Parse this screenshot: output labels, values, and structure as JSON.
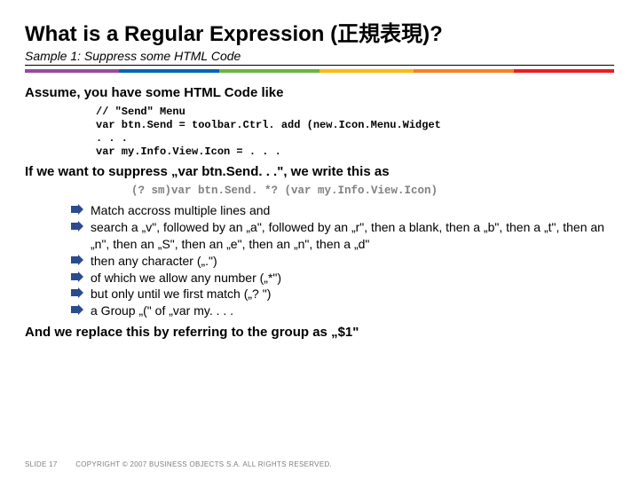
{
  "title": "What is a Regular Expression (正規表現)?",
  "subtitle": "Sample 1: Suppress some HTML Code",
  "h_assume": "Assume, you have some HTML Code like",
  "code1": "// \"Send\" Menu\nvar btn.Send = toolbar.Ctrl. add (new.Icon.Menu.Widget\n. . .\nvar my.Info.View.Icon = . . .",
  "h_want": "If we want to suppress „var btn.Send. . .\", we write this as",
  "regex": "(? sm)var btn.Send. *? (var my.Info.View.Icon)",
  "bullets": {
    "b1": "Match accross multiple lines and",
    "b2": "search a „v\", followed by an „a\", followed by an „r\", then a blank, then a „b\", then a „t\", then an „n\", then an „S\", then an „e\", then an „n\", then a „d\"",
    "b3": "then any character („.\")",
    "b4": "of which we allow any number („*\")",
    "b5": "but only until we first match („? \")",
    "b6": "a Group „(\" of „var my. . . ."
  },
  "h_replace_pre": "And we replace this by referring to the group as „",
  "h_replace_dollar": "$1",
  "h_replace_post": "\"",
  "footer": {
    "slidenum": "SLIDE 17",
    "copyright": "COPYRIGHT © 2007 BUSINESS OBJECTS S.A.  ALL RIGHTS RESERVED."
  }
}
